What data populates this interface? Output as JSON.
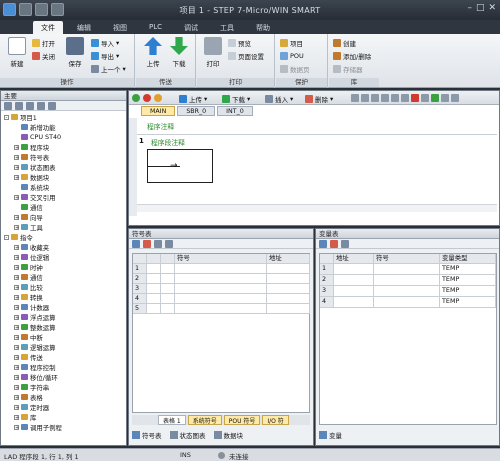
{
  "app": {
    "title": "项目 1 - STEP 7-Micro/WIN SMART"
  },
  "ribbon_tabs": [
    "文件",
    "编辑",
    "视图",
    "PLC",
    "调试",
    "工具",
    "帮助"
  ],
  "ribbon": {
    "new": "新建",
    "open": "打开",
    "close": "关闭",
    "save": "保存",
    "import": "导入",
    "export": "导出",
    "previous": "上一个",
    "group_operations": "操作",
    "upload": "上传",
    "download": "下载",
    "group_transfer": "传送",
    "print": "打印",
    "preview": "预览",
    "page_setup": "页面设置",
    "group_print": "打印",
    "project": "项目",
    "pou": "POU",
    "data_page": "数据页",
    "group_protect": "保护",
    "create": "创建",
    "add_delete": "添加/删除",
    "memory_card": "存储器",
    "group_library": "库"
  },
  "left_panel": {
    "title": "主要",
    "tree": [
      {
        "label": "项目1",
        "level": 0,
        "expander": "-"
      },
      {
        "label": "新增功能",
        "level": 1,
        "expander": ""
      },
      {
        "label": "CPU ST40",
        "level": 1,
        "expander": ""
      },
      {
        "label": "程序块",
        "level": 1,
        "expander": "+"
      },
      {
        "label": "符号表",
        "level": 1,
        "expander": "+"
      },
      {
        "label": "状态图表",
        "level": 1,
        "expander": "+"
      },
      {
        "label": "数据块",
        "level": 1,
        "expander": "+"
      },
      {
        "label": "系统块",
        "level": 1,
        "expander": ""
      },
      {
        "label": "交叉引用",
        "level": 1,
        "expander": "+"
      },
      {
        "label": "通信",
        "level": 1,
        "expander": ""
      },
      {
        "label": "向导",
        "level": 1,
        "expander": "+"
      },
      {
        "label": "工具",
        "level": 1,
        "expander": "+"
      },
      {
        "label": "指令",
        "level": 0,
        "expander": "-"
      },
      {
        "label": "收藏夹",
        "level": 1,
        "expander": "+"
      },
      {
        "label": "位逻辑",
        "level": 1,
        "expander": "+"
      },
      {
        "label": "时钟",
        "level": 1,
        "expander": "+"
      },
      {
        "label": "通信",
        "level": 1,
        "expander": "+"
      },
      {
        "label": "比较",
        "level": 1,
        "expander": "+"
      },
      {
        "label": "转换",
        "level": 1,
        "expander": "+"
      },
      {
        "label": "计数器",
        "level": 1,
        "expander": "+"
      },
      {
        "label": "浮点运算",
        "level": 1,
        "expander": "+"
      },
      {
        "label": "整数运算",
        "level": 1,
        "expander": "+"
      },
      {
        "label": "中断",
        "level": 1,
        "expander": "+"
      },
      {
        "label": "逻辑运算",
        "level": 1,
        "expander": "+"
      },
      {
        "label": "传送",
        "level": 1,
        "expander": "+"
      },
      {
        "label": "程序控制",
        "level": 1,
        "expander": "+"
      },
      {
        "label": "移位/循环",
        "level": 1,
        "expander": "+"
      },
      {
        "label": "字符串",
        "level": 1,
        "expander": "+"
      },
      {
        "label": "表格",
        "level": 1,
        "expander": "+"
      },
      {
        "label": "定时器",
        "level": 1,
        "expander": "+"
      },
      {
        "label": "库",
        "level": 1,
        "expander": "+"
      },
      {
        "label": "调用子例程",
        "level": 1,
        "expander": "+"
      }
    ]
  },
  "editor": {
    "toolbar": {
      "upload": "上传",
      "download": "下载",
      "insert": "插入",
      "delete": "删除"
    },
    "tabs": [
      "MAIN",
      "SBR_0",
      "INT_0"
    ],
    "program_comment": "程序注释",
    "network_number": "1",
    "network_comment": "程序段注释"
  },
  "symbol_table": {
    "title": "符号表",
    "columns": [
      "符号",
      "地址"
    ],
    "rows": [
      "1",
      "2",
      "3",
      "4",
      "5"
    ],
    "bottom_tabs": [
      "表格 1",
      "系统符号",
      "POU 符号",
      "I/O 符"
    ]
  },
  "var_table": {
    "title": "变量表",
    "columns": [
      "地址",
      "符号",
      "变量类型"
    ],
    "rows": [
      {
        "n": "1",
        "type": "TEMP"
      },
      {
        "n": "2",
        "type": "TEMP"
      },
      {
        "n": "3",
        "type": "TEMP"
      },
      {
        "n": "4",
        "type": "TEMP"
      }
    ]
  },
  "bottom_nav": {
    "symbol": "符号表",
    "status": "状态图表",
    "data": "数据块",
    "var": "变量"
  },
  "status": {
    "position": "LAD 程序段 1, 行 1, 列 1",
    "mode": "INS",
    "connection": "未连接"
  }
}
